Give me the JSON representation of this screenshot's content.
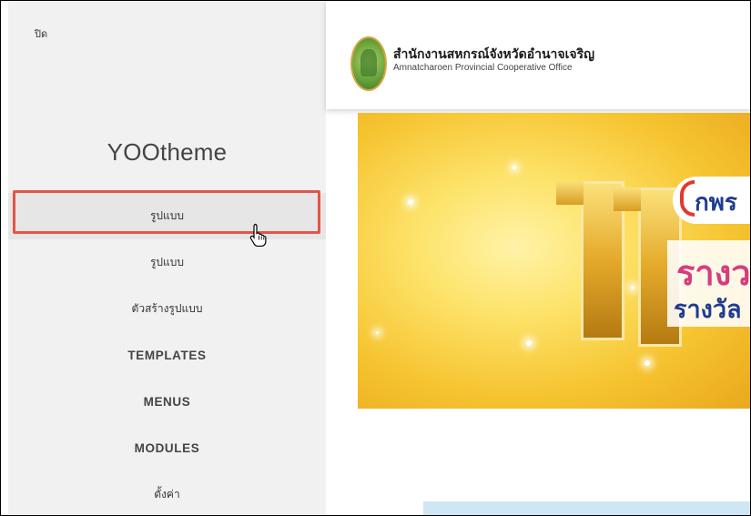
{
  "sidebar": {
    "close_label": "ปิด",
    "brand": "YOOtheme",
    "items": [
      {
        "label": "รูปแบบ",
        "active": true
      },
      {
        "label": "รูปแบบ"
      },
      {
        "label": "ตัวสร้างรูปแบบ"
      },
      {
        "label": "TEMPLATES"
      },
      {
        "label": "MENUS"
      },
      {
        "label": "MODULES"
      },
      {
        "label": "ตั้งค่า"
      }
    ]
  },
  "preview": {
    "org_name_th": "สำนักงานสหกรณ์จังหวัดอำนาจเจริญ",
    "org_name_en": "Amnatcharoen Provincial Cooperative Office",
    "banner": {
      "number": "11",
      "badge": "กพร",
      "line1": "รางว",
      "line2": "รางวัล"
    }
  },
  "colors": {
    "highlight": "#e45547",
    "sidebar_bg": "#f1f1f1",
    "banner_gold": "#f6c431",
    "badge_blue": "#1f3d8f",
    "award_pink": "#d63d7d"
  },
  "icons": {
    "cursor": "hand-pointer-icon",
    "logo": "cooperative-seal-logo"
  }
}
